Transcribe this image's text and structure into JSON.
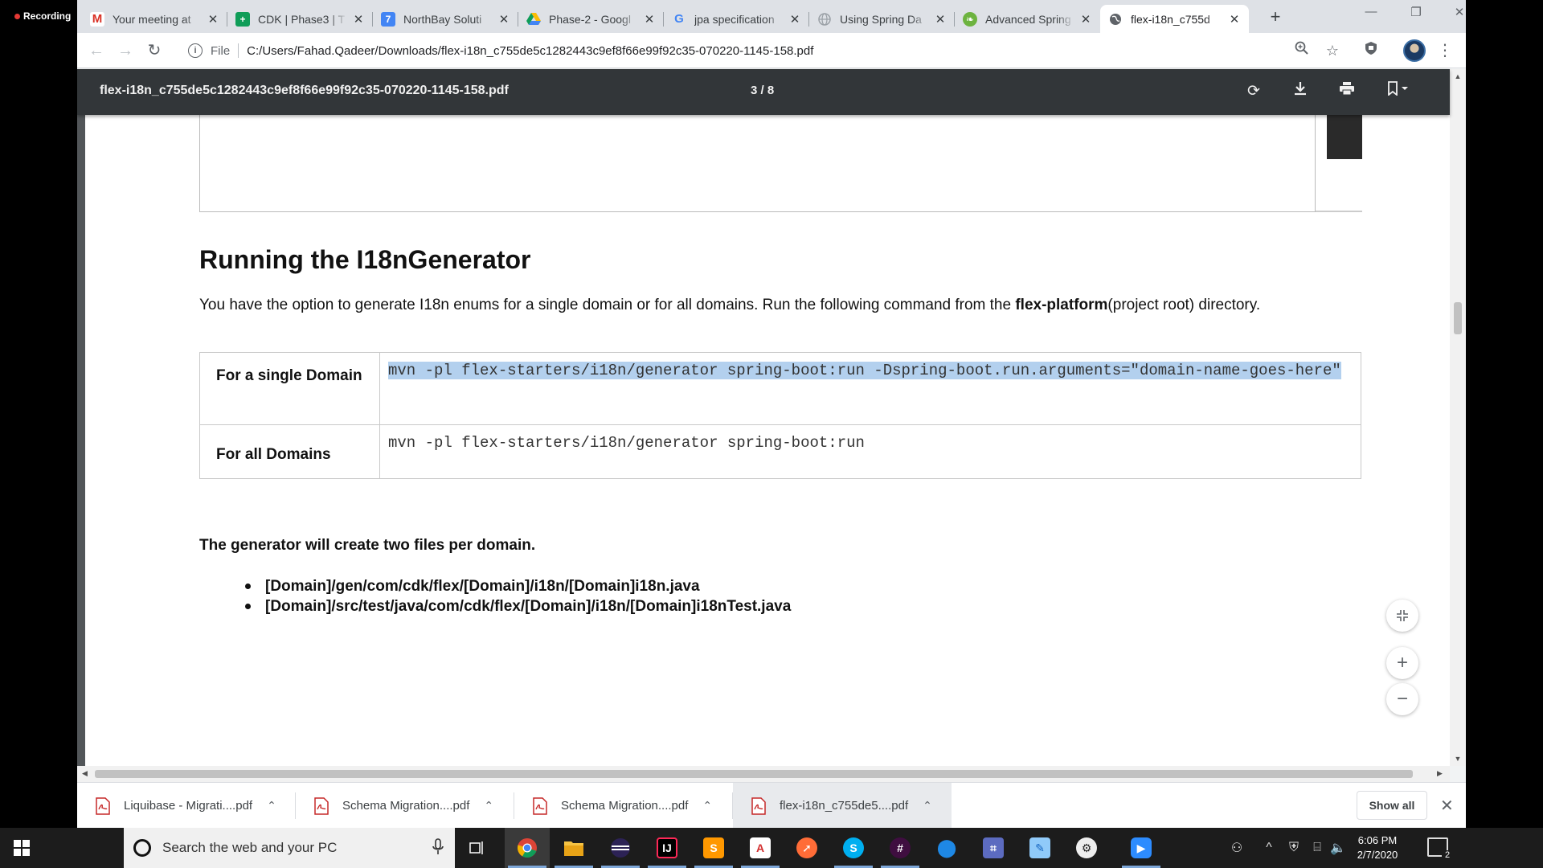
{
  "recording": {
    "label": "Recording"
  },
  "tabs": [
    {
      "title": "Your meeting at",
      "favicon": "gmail-icon",
      "active": false
    },
    {
      "title": "CDK | Phase3 | T",
      "favicon": "sheets-icon",
      "active": false
    },
    {
      "title": "NorthBay Soluti",
      "favicon": "calendar-icon",
      "active": false
    },
    {
      "title": "Phase-2 - Googl",
      "favicon": "drive-icon",
      "active": false
    },
    {
      "title": "jpa specification",
      "favicon": "google-icon",
      "active": false
    },
    {
      "title": "Using Spring Da",
      "favicon": "globe-icon",
      "active": false
    },
    {
      "title": "Advanced Spring",
      "favicon": "spring-icon",
      "active": false
    },
    {
      "title": "flex-i18n_c755d",
      "favicon": "globe-icon",
      "active": true
    }
  ],
  "address": {
    "scheme": "File",
    "url": "C:/Users/Fahad.Qadeer/Downloads/flex-i18n_c755de5c1282443c9ef8f66e99f92c35-070220-1145-158.pdf"
  },
  "pdf": {
    "filename": "flex-i18n_c755de5c1282443c9ef8f66e99f92c35-070220-1145-158.pdf",
    "page_indicator": "3 / 8"
  },
  "doc": {
    "heading": "Running the I18nGenerator",
    "para_pre": "You have the option to generate I18n enums for a single domain or for all domains. Run the following command from the ",
    "para_bold": "flex-platform",
    "para_post": "(project root) directory.",
    "rows": [
      {
        "label": "For a single Domain",
        "command": "mvn -pl flex-starters/i18n/generator spring-boot:run -Dspring-boot.run.arguments=\"domain-name-goes-here\""
      },
      {
        "label": "For all Domains",
        "command": "mvn -pl flex-starters/i18n/generator spring-boot:run"
      }
    ],
    "generator_note": "The generator will create two files per domain.",
    "files": [
      "[Domain]/gen/com/cdk/flex/[Domain]/i18n/[Domain]i18n.java",
      "[Domain]/src/test/java/com/cdk/flex/[Domain]/i18n/[Domain]i18nTest.java"
    ]
  },
  "downloads": [
    {
      "name": "Liquibase - Migrati....pdf"
    },
    {
      "name": "Schema Migration....pdf"
    },
    {
      "name": "Schema Migration....pdf"
    },
    {
      "name": "flex-i18n_c755de5....pdf"
    }
  ],
  "downloads_show_all": "Show all",
  "taskbar": {
    "search_placeholder": "Search the web and your PC",
    "time": "6:06 PM",
    "date": "2/7/2020",
    "notification_count": "2"
  },
  "colors": {
    "pdf_toolbar": "#323639",
    "selection": "#b3d0ee",
    "taskbar": "#1c1c1c"
  }
}
